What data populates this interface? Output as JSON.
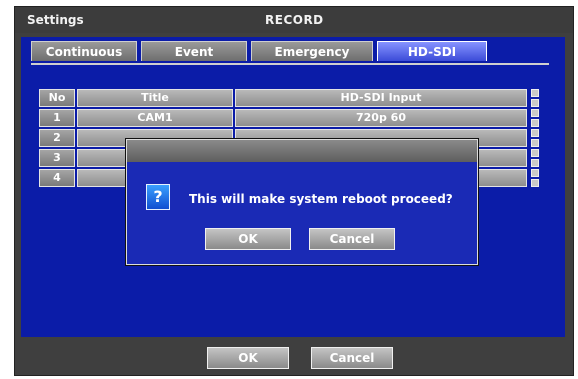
{
  "header": {
    "left_label": "Settings",
    "title": "RECORD"
  },
  "tabs": [
    {
      "label": "Continuous"
    },
    {
      "label": "Event"
    },
    {
      "label": "Emergency"
    },
    {
      "label": "HD-SDI",
      "active": true
    }
  ],
  "table": {
    "columns": [
      "No",
      "Title",
      "HD-SDI Input"
    ],
    "rows": [
      {
        "no": "1",
        "title": "CAM1",
        "input": "720p 60"
      },
      {
        "no": "2",
        "title": "",
        "input": ""
      },
      {
        "no": "3",
        "title": "",
        "input": ""
      },
      {
        "no": "4",
        "title": "",
        "input": ""
      }
    ]
  },
  "dialog": {
    "icon": "question-icon",
    "icon_glyph": "?",
    "message": "This will make system reboot proceed?",
    "ok_label": "OK",
    "cancel_label": "Cancel"
  },
  "footer": {
    "ok_label": "OK",
    "cancel_label": "Cancel"
  },
  "colors": {
    "panel_blue": "#0b1ca8",
    "active_tab": "#3b4bd8",
    "frame_gray": "#3f3f3f"
  }
}
